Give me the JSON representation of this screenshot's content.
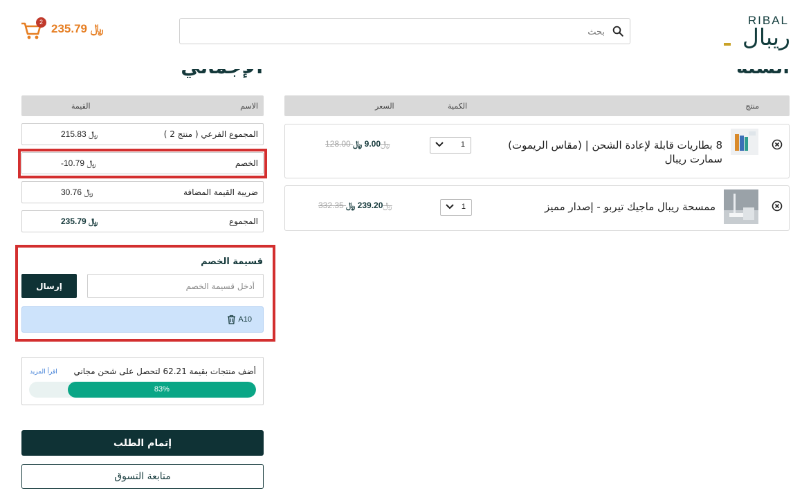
{
  "header": {
    "logo_latin": "RIBAL",
    "logo_arabic": "ريبال",
    "search_placeholder": "بحث",
    "cart_count": "2",
    "cart_total": "235.79 ﷼"
  },
  "cart": {
    "heading": "السلة",
    "columns": {
      "product": "منتج",
      "quantity": "الكمية",
      "price": "السعر"
    },
    "items": [
      {
        "name": "8 بطاريات قابلة لإعادة الشحن | (مقاس الريموت) سمارت ريبال",
        "quantity": "1",
        "price": "9.00 ﷼",
        "old_price": "128.00 ﷼"
      },
      {
        "name": "ممسحة ريبال ماجيك تيربو - إصدار مميز",
        "quantity": "1",
        "price": "239.20 ﷼",
        "old_price": "332.35 ﷼"
      }
    ]
  },
  "summary": {
    "heading": "الإجمالي",
    "col_name": "الاسم",
    "col_value": "القيمة",
    "rows": [
      {
        "label": "المجموع الفرعي ( منتج 2 )",
        "value": "215.83 ﷼"
      },
      {
        "label": "الخصم",
        "value": "-10.79 ﷼"
      },
      {
        "label": "ضريبة القيمة المضافة",
        "value": "30.76 ﷼"
      },
      {
        "label": "المجموع",
        "value": "235.79 ﷼"
      }
    ]
  },
  "coupon": {
    "title": "قسيمة الخصم",
    "placeholder": "أدخل قسيمة الخصم",
    "submit": "إرسال",
    "applied_code": "A10"
  },
  "shipping": {
    "message": "أضف منتجات بقيمة 62.21 لتحصل على شحن مجاني",
    "read_more": "اقرأ المزيد",
    "progress": 83,
    "progress_label": "83%"
  },
  "actions": {
    "checkout": "إتمام الطلب",
    "continue": "متابعة التسوق"
  },
  "colors": {
    "primary": "#0f3235",
    "accent": "#e67e22",
    "progress": "#0aa686",
    "highlight": "#d32f2f"
  }
}
